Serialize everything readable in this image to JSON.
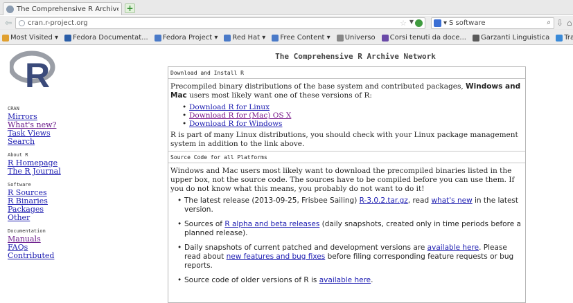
{
  "browser": {
    "tab_title": "The Comprehensive R Archive N...",
    "new_tab_symbol": "+",
    "url": "cran.r-project.org",
    "search_text": "S software",
    "search_engine_caret": "▾",
    "bookmarks": [
      {
        "label": "Most Visited ▾",
        "color": "#e0a030"
      },
      {
        "label": "Fedora Documentat...",
        "color": "#2a5ea8"
      },
      {
        "label": "Fedora Project ▾",
        "color": "#4a7ac8"
      },
      {
        "label": "Red Hat ▾",
        "color": "#4a7ac8"
      },
      {
        "label": "Free Content ▾",
        "color": "#4a7ac8"
      },
      {
        "label": "Universo",
        "color": "#888888"
      },
      {
        "label": "Corsi tenuti da doce...",
        "color": "#6a4aa8"
      },
      {
        "label": "Garzanti Linguistica",
        "color": "#5a5a5a"
      },
      {
        "label": "Translate",
        "color": "#3a8ad8"
      }
    ]
  },
  "page": {
    "title": "The Comprehensive R Archive Network"
  },
  "sidebar": {
    "sections": [
      {
        "heading": "CRAN",
        "links": [
          {
            "label": "Mirrors",
            "visited": false
          },
          {
            "label": "What's new?",
            "visited": true
          },
          {
            "label": "Task Views",
            "visited": false
          },
          {
            "label": "Search",
            "visited": false
          }
        ]
      },
      {
        "heading": "About R",
        "links": [
          {
            "label": "R Homepage",
            "visited": false
          },
          {
            "label": "The R Journal",
            "visited": false
          }
        ]
      },
      {
        "heading": "Software",
        "links": [
          {
            "label": "R Sources",
            "visited": false
          },
          {
            "label": "R Binaries",
            "visited": false
          },
          {
            "label": "Packages",
            "visited": false
          },
          {
            "label": "Other",
            "visited": false
          }
        ]
      },
      {
        "heading": "Documentation",
        "links": [
          {
            "label": "Manuals",
            "visited": true
          },
          {
            "label": "FAQs",
            "visited": false
          },
          {
            "label": "Contributed",
            "visited": false
          }
        ]
      }
    ]
  },
  "download": {
    "heading": "Download and Install R",
    "intro_pre": "Precompiled binary distributions of the base system and contributed packages, ",
    "intro_bold": "Windows and Mac",
    "intro_post": " users most likely want one of these versions of R:",
    "links": [
      {
        "label": "Download R for Linux",
        "visited": false
      },
      {
        "label": "Download R for (Mac) OS X",
        "visited": true
      },
      {
        "label": "Download R for Windows",
        "visited": false
      }
    ],
    "note": "R is part of many Linux distributions, you should check with your Linux package management system in addition to the link above."
  },
  "source": {
    "heading": "Source Code for all Platforms",
    "intro": "Windows and Mac users most likely want to download the precompiled binaries listed in the upper box, not the source code. The sources have to be compiled before you can use them. If you do not know what this means, you probably do not want to do it!",
    "items": [
      {
        "pre": "The latest release (2013-09-25, Frisbee Sailing) ",
        "link1": "R-3.0.2.tar.gz",
        "mid": ", read ",
        "link2": "what's new",
        "post": " in the latest version."
      },
      {
        "pre": "Sources of ",
        "link1": "R alpha and beta releases",
        "mid": " (daily snapshots, created only in time periods before a planned release).",
        "link2": "",
        "post": ""
      },
      {
        "pre": "Daily snapshots of current patched and development versions are ",
        "link1": "available here",
        "mid": ". Please read about ",
        "link2": "new features and bug fixes",
        "post": " before filing corresponding feature requests or bug reports."
      },
      {
        "pre": "Source code of older versions of R is ",
        "link1": "available here",
        "mid": ".",
        "link2": "",
        "post": ""
      }
    ]
  }
}
